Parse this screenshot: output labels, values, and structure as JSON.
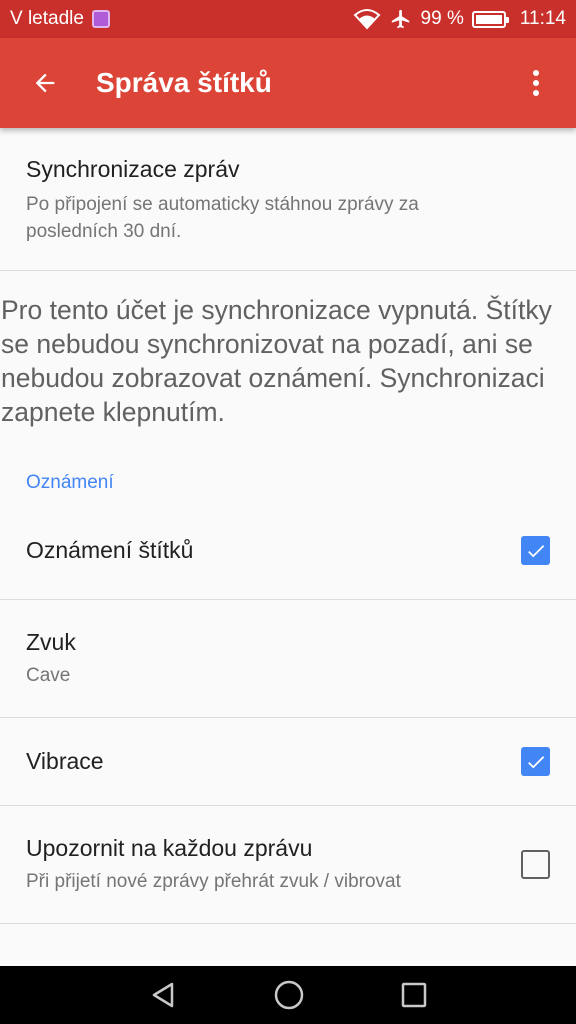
{
  "status_bar": {
    "carrier": "V letadle",
    "battery_pct": "99 %",
    "battery_level": 0.99,
    "time": "11:14",
    "icons": [
      "image-notification-icon",
      "wifi-icon",
      "airplane-mode-icon",
      "battery-icon"
    ]
  },
  "app_bar": {
    "title": "Správa štítků",
    "back_icon": "arrow-back-icon",
    "overflow_icon": "more-vert-icon"
  },
  "sync": {
    "title": "Synchronizace zpráv",
    "summary": "Po připojení se automaticky stáhnou zprávy za posledních 30 dní."
  },
  "notice": "Pro tento účet je synchronizace vypnutá. Štítky se nebudou synchronizovat na pozadí, ani se nebudou zobrazovat oznámení. Synchronizaci zapnete klepnutím.",
  "notifications_section": {
    "header": "Oznámení",
    "items": [
      {
        "title": "Oznámení štítků",
        "summary": "",
        "checked": true
      },
      {
        "title": "Zvuk",
        "summary": "Cave"
      },
      {
        "title": "Vibrace",
        "summary": "",
        "checked": true
      },
      {
        "title": "Upozornit na každou zprávu",
        "summary": "Při přijetí nové zprávy přehrát zvuk / vibrovat",
        "checked": false
      }
    ]
  },
  "nav_bar": {
    "icons": [
      "back-nav-icon",
      "home-nav-icon",
      "recents-nav-icon"
    ]
  },
  "colors": {
    "status_bar": "#c9302c",
    "app_bar": "#db4437",
    "accent": "#4285f4"
  }
}
